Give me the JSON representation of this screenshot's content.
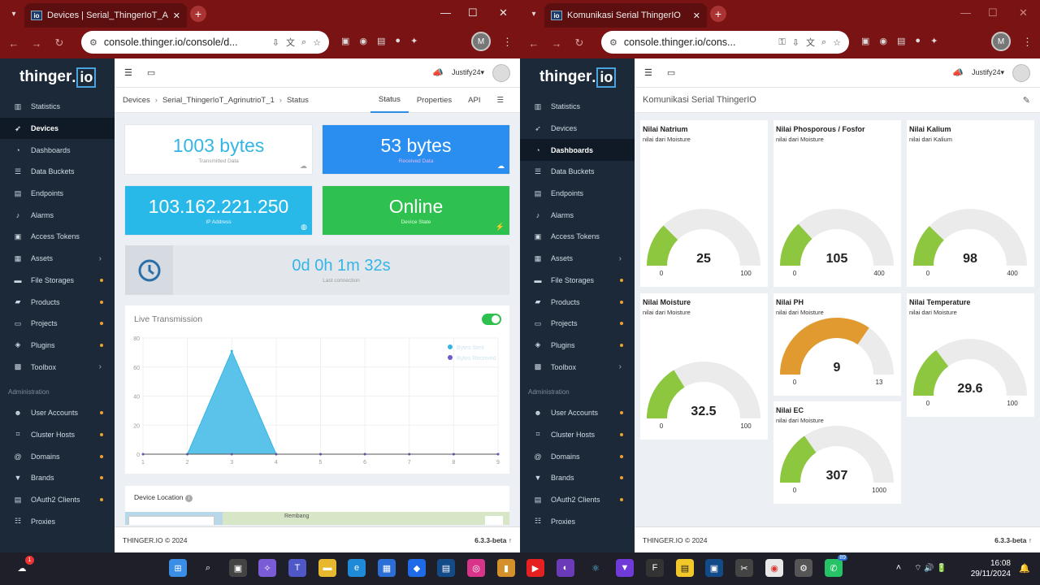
{
  "left": {
    "tab_title": "Devices | Serial_ThingerIoT_Agr",
    "url": "console.thinger.io/console/d...",
    "logo": "thinger",
    "logo_box": "io",
    "user": "Justify24",
    "breadcrumb": [
      "Devices",
      "Serial_ThingerIoT_AgrinutrioT_1",
      "Status"
    ],
    "tabs": [
      "Status",
      "Properties",
      "API"
    ],
    "stats": [
      {
        "value": "1003 bytes",
        "label": "Transmitted Data"
      },
      {
        "value": "53 bytes",
        "label": "Received Data"
      },
      {
        "value": "103.162.221.250",
        "label": "IP Address"
      },
      {
        "value": "Online",
        "label": "Device State"
      }
    ],
    "last_connection": {
      "value": "0d 0h 1m 32s",
      "label": "Last connection"
    },
    "live_title": "Live Transmission",
    "location_title": "Device Location",
    "map_label": "Rembang",
    "chart_data": {
      "type": "area",
      "x": [
        1,
        2,
        3,
        4,
        5,
        6,
        7,
        8,
        9
      ],
      "series": [
        {
          "name": "Bytes Sent",
          "values": [
            0,
            0,
            71,
            0,
            0,
            0,
            0,
            0,
            0
          ],
          "color": "#35b5e5"
        },
        {
          "name": "Bytes Received",
          "values": [
            0,
            0,
            0,
            0,
            0,
            0,
            0,
            0,
            0
          ],
          "color": "#6a5acd"
        }
      ],
      "yticks": [
        0,
        20,
        40,
        60,
        80
      ],
      "ylim": [
        0,
        80
      ]
    }
  },
  "right": {
    "tab_title": "Komunikasi Serial ThingerIO",
    "url": "console.thinger.io/cons...",
    "user": "Justify24",
    "page_title": "Komunikasi Serial ThingerIO",
    "gauges": [
      {
        "title": "Nilai Natrium",
        "sub": "nilai dari Moisture",
        "value": "25",
        "min": "0",
        "max": "100",
        "frac": 0.25,
        "color": "#8dc63f"
      },
      {
        "title": "Nilai Phosporous / Fosfor",
        "sub": "nilai dari Moisture",
        "value": "105",
        "min": "0",
        "max": "400",
        "frac": 0.2625,
        "color": "#8dc63f"
      },
      {
        "title": "Nilai Kalium",
        "sub": "nilai dari Kalium",
        "value": "98",
        "min": "0",
        "max": "400",
        "frac": 0.245,
        "color": "#8dc63f"
      },
      {
        "title": "Nilai Moisture",
        "sub": "nilai dari Moisture",
        "value": "32.5",
        "min": "0",
        "max": "100",
        "frac": 0.325,
        "color": "#8dc63f"
      },
      {
        "title": "Nilai PH",
        "sub": "nilai dari Moisture",
        "value": "9",
        "min": "0",
        "max": "13",
        "frac": 0.692,
        "color": "#e09a2f"
      },
      {
        "title": "Nilai Temperature",
        "sub": "nilai dari Moisture",
        "value": "29.6",
        "min": "0",
        "max": "100",
        "frac": 0.296,
        "color": "#8dc63f"
      },
      {
        "title": "Nilai EC",
        "sub": "nilai dari Moisture",
        "value": "307",
        "min": "0",
        "max": "1000",
        "frac": 0.307,
        "color": "#8dc63f"
      }
    ]
  },
  "sidebar": {
    "items": [
      {
        "label": "Statistics",
        "icon": "chart-icon"
      },
      {
        "label": "Devices",
        "icon": "rocket-icon"
      },
      {
        "label": "Dashboards",
        "icon": "dashboard-icon"
      },
      {
        "label": "Data Buckets",
        "icon": "database-icon"
      },
      {
        "label": "Endpoints",
        "icon": "endpoint-icon"
      },
      {
        "label": "Alarms",
        "icon": "bell-icon"
      },
      {
        "label": "Access Tokens",
        "icon": "lock-icon"
      },
      {
        "label": "Assets",
        "icon": "building-icon"
      },
      {
        "label": "File Storages",
        "icon": "hdd-icon"
      },
      {
        "label": "Products",
        "icon": "product-icon"
      },
      {
        "label": "Projects",
        "icon": "folder-icon"
      },
      {
        "label": "Plugins",
        "icon": "cube-icon"
      },
      {
        "label": "Toolbox",
        "icon": "toolbox-icon"
      }
    ],
    "admin_label": "Administration",
    "admin_items": [
      {
        "label": "User Accounts",
        "icon": "users-icon"
      },
      {
        "label": "Cluster Hosts",
        "icon": "sitemap-icon"
      },
      {
        "label": "Domains",
        "icon": "at-icon"
      },
      {
        "label": "Brands",
        "icon": "bookmark-icon"
      },
      {
        "label": "OAuth2 Clients",
        "icon": "oauth-icon"
      },
      {
        "label": "Proxies",
        "icon": "proxy-icon"
      }
    ]
  },
  "footer": {
    "copyright": "THINGER.IO © 2024",
    "version": "6.3.3-beta"
  },
  "taskbar": {
    "time": "16:08",
    "date": "29/11/2024",
    "weather_badge": "1",
    "whatsapp_badge": "89"
  }
}
